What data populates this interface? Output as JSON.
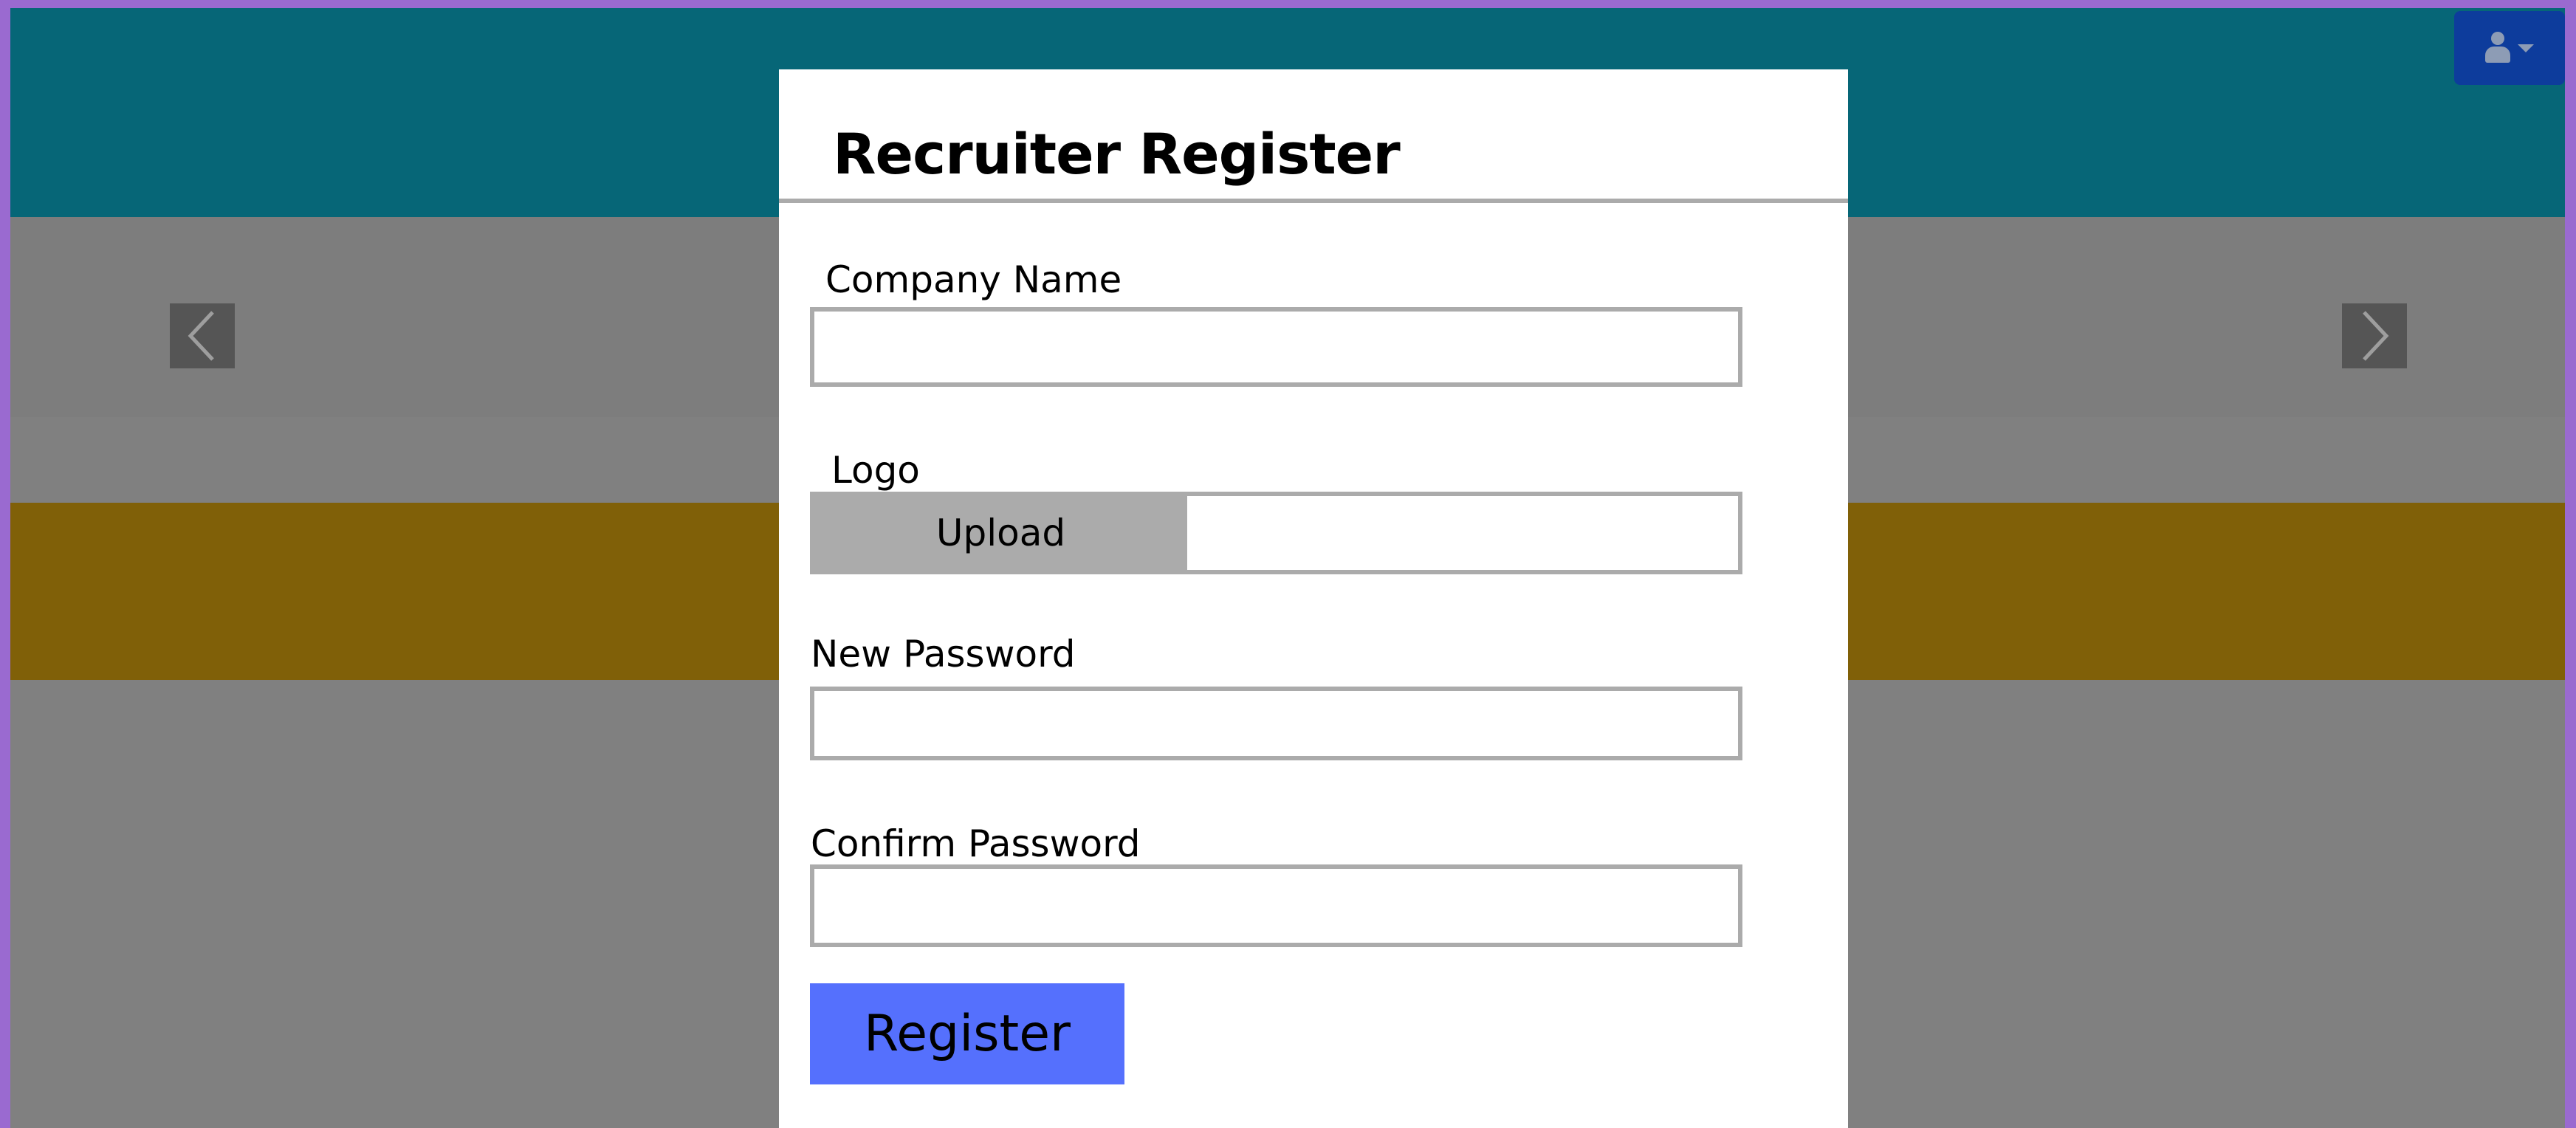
{
  "colors": {
    "page_border": "#9a6ad0",
    "header_band": "#066677",
    "carousel_band": "#7d7d7d",
    "gold_band": "#806008",
    "backdrop": "#808080",
    "modal_bg": "#ffffff",
    "input_border": "#ababab",
    "upload_button": "#ababab",
    "register_button": "#5570fd",
    "user_button": "#0d3c9c",
    "carousel_arrow_bg": "#555555",
    "carousel_arrow_icon": "#9e9e9e"
  },
  "icons": {
    "user_menu": "user-icon",
    "user_menu_caret": "caret-down-icon",
    "carousel_prev": "chevron-left-icon",
    "carousel_next": "chevron-right-icon"
  },
  "modal": {
    "title": "Recruiter Register",
    "company_name_label": "Company Name",
    "company_name_value": "",
    "logo_label": "Logo",
    "upload_label": "Upload",
    "upload_filename": "",
    "new_password_label": "New Password",
    "new_password_value": "",
    "confirm_password_label": "Confirm Password",
    "confirm_password_value": "",
    "register_label": "Register"
  }
}
